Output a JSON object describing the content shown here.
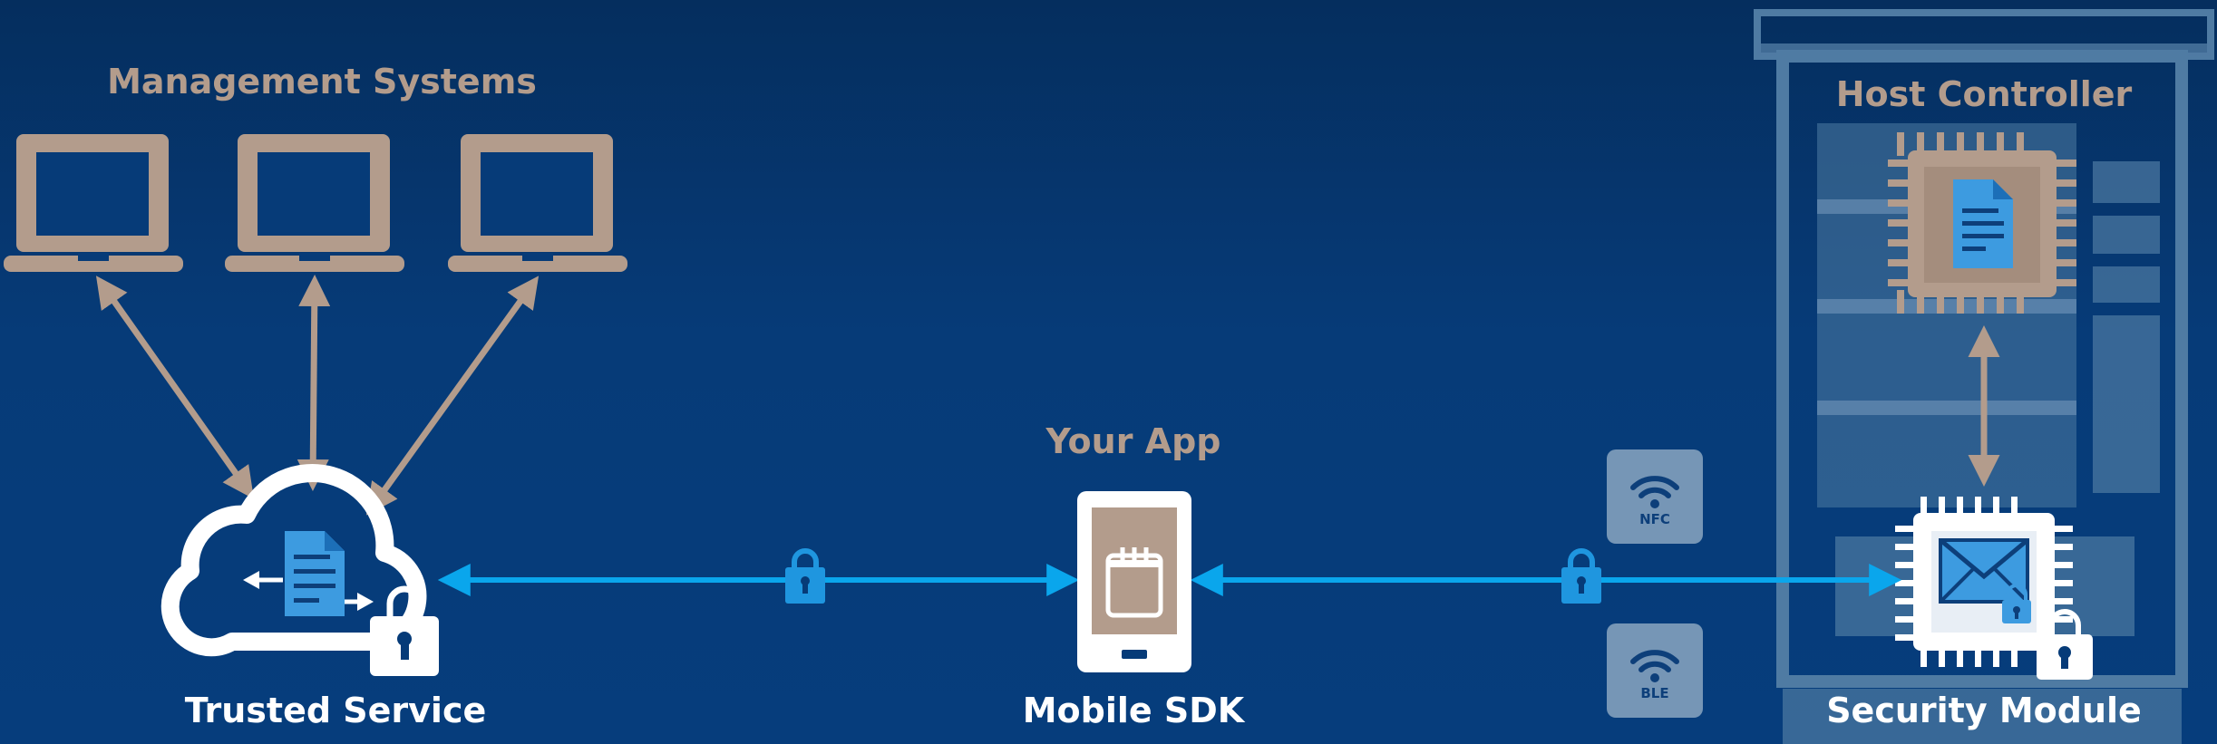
{
  "labels": {
    "management_systems": "Management Systems",
    "host_controller": "Host Controller",
    "your_app": "Your App",
    "trusted_service": "Trusted Service",
    "mobile_sdk": "Mobile SDK",
    "security_module": "Security Module",
    "nfc": "NFC",
    "ble": "BLE"
  },
  "colors": {
    "background": "#063b78",
    "tan": "#b39c8c",
    "bright_blue": "#0aa6ec",
    "doc_blue": "#3d9be0",
    "white": "#ffffff",
    "panel": "#4f7ba3"
  },
  "icons": {
    "laptop": "laptop-icon",
    "cloud": "cloud-icon",
    "document": "document-icon",
    "padlock": "padlock-icon",
    "smartphone": "smartphone-icon",
    "chip": "chip-icon",
    "envelope": "envelope-icon",
    "wifi": "wifi-icon"
  }
}
